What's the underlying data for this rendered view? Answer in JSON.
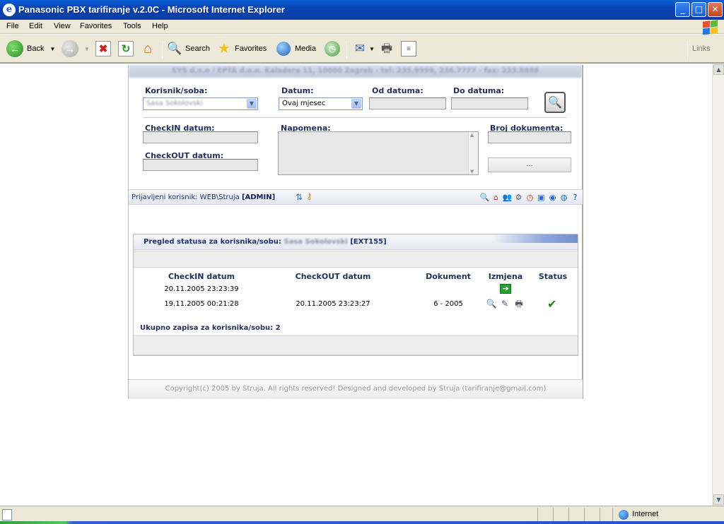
{
  "window": {
    "title": "Panasonic PBX tarifiranje v.2.0C - Microsoft Internet Explorer",
    "ie_letter": "e",
    "min": "_",
    "max": "□",
    "close": "✕"
  },
  "menu": [
    "File",
    "Edit",
    "View",
    "Favorites",
    "Tools",
    "Help"
  ],
  "toolbar": {
    "back": "Back",
    "search": "Search",
    "favorites": "Favorites",
    "media": "Media",
    "links": "Links"
  },
  "header": {
    "company": "SYS d.o.o / EPTA d.o.o. Kaladera 11, 10000 Zagreb - tel: 235.9999, 236.7777 - fax: 233.8888"
  },
  "form": {
    "korisnik_label": "Korisnik/soba:",
    "korisnik_value": "Sasa Sokolovski",
    "datum_label": "Datum:",
    "datum_value": "Ovaj mjesec",
    "od_label": "Od datuma:",
    "do_label": "Do datuma:",
    "checkin_label": "CheckIN datum:",
    "checkout_label": "CheckOUT datum:",
    "napomena_label": "Napomena:",
    "broj_label": "Broj dokumenta:",
    "dots_button": "...",
    "search_glyph": "🔍"
  },
  "infobar": {
    "prefix": "Prijavljeni korisnik: WEB\\Struja",
    "role": "[ADMIN]"
  },
  "panel": {
    "title_prefix": "Pregled statusa za korisnika/sobu:",
    "user": "Sasa Sokolovski",
    "ext": "[EXT155]",
    "columns": [
      "CheckIN datum",
      "CheckOUT datum",
      "Dokument",
      "Izmjena",
      "Status"
    ],
    "rows": [
      {
        "checkin": "20.11.2005 23:23:39",
        "checkout": "",
        "dokument": ""
      },
      {
        "checkin": "19.11.2005 00:21:28",
        "checkout": "20.11.2005 23:23:27",
        "dokument": "6 - 2005"
      }
    ],
    "total": "Ukupno zapisa za korisnika/sobu: 2"
  },
  "footer": "Copyright(c) 2005 by Struja. All rights reserved! Designed and developed by Struja (tarifiranje@gmail.com)",
  "statusbar": {
    "zone": "Internet"
  }
}
